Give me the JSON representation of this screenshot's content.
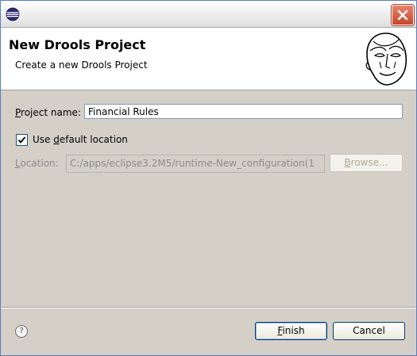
{
  "window": {
    "title": ""
  },
  "header": {
    "title": "New Drools Project",
    "description": "Create a new Drools Project"
  },
  "form": {
    "project_name": {
      "label_prefix": "",
      "label_mnemonic": "P",
      "label_rest": "roject name:",
      "value": "Financial Rules"
    },
    "use_default_location": {
      "checked": true,
      "label_prefix": "Use ",
      "label_mnemonic": "d",
      "label_rest": "efault location"
    },
    "location": {
      "label_prefix": "",
      "label_mnemonic": "L",
      "label_rest": "ocation:",
      "value": "C:/apps/eclipse3.2M5/runtime-New_configuration(1",
      "enabled": false
    },
    "browse": {
      "label_prefix": "",
      "label_mnemonic": "B",
      "label_rest": "rowse...",
      "enabled": false
    }
  },
  "footer": {
    "help_symbol": "?",
    "finish": {
      "label_prefix": "",
      "label_mnemonic": "F",
      "label_rest": "inish"
    },
    "cancel": {
      "label": "Cancel"
    }
  },
  "icons": {
    "app": "eclipse-icon",
    "close": "close-icon",
    "logo": "drools-head-icon",
    "help": "help-icon",
    "check": "checkmark-icon"
  },
  "colors": {
    "close_button": "#c7452b",
    "field_border": "#7f9db9",
    "button_border": "#003c74"
  }
}
